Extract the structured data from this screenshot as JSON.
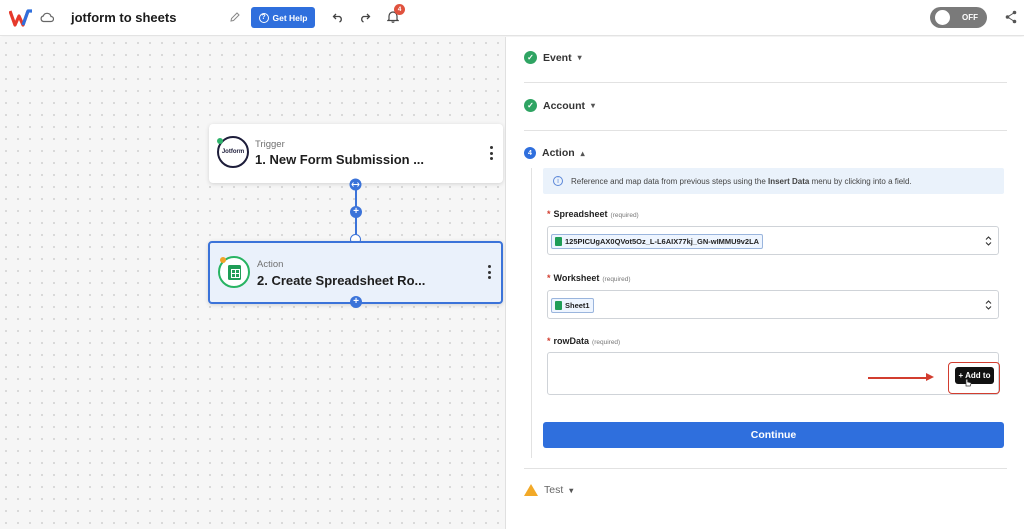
{
  "header": {
    "title": "jotform to sheets",
    "help_label": "Get Help",
    "help_icon": "?",
    "notifications_count": "4",
    "toggle_label": "OFF"
  },
  "canvas": {
    "trigger": {
      "kind": "Trigger",
      "name": "1. New Form Submission ...",
      "app_logo": "Jotform"
    },
    "action": {
      "kind": "Action",
      "name": "2. Create Spreadsheet Ro..."
    },
    "add_step_icon": "+"
  },
  "panel": {
    "sections": {
      "event": "Event",
      "account": "Account",
      "action": "Action",
      "action_step_number": "4",
      "test": "Test"
    },
    "info_text_before": "Reference and map data from previous steps using the ",
    "info_text_bold": "Insert Data",
    "info_text_after": " menu by clicking into a field.",
    "fields": {
      "spreadsheet_label": "Spreadsheet",
      "spreadsheet_value": "125PICUgAX0QVot5Oz_L-L6AIX77kj_GN-wIMMU9v2LA",
      "worksheet_label": "Worksheet",
      "worksheet_value": "Sheet1",
      "rowdata_label": "rowData",
      "required_text": "(required)",
      "required_marker": "*"
    },
    "add_to_label": "+ Add to",
    "continue_label": "Continue"
  },
  "colors": {
    "primary": "#2f6fdd",
    "success": "#2fa463",
    "warning": "#f2a928",
    "annotation_red": "#d23d2f"
  }
}
